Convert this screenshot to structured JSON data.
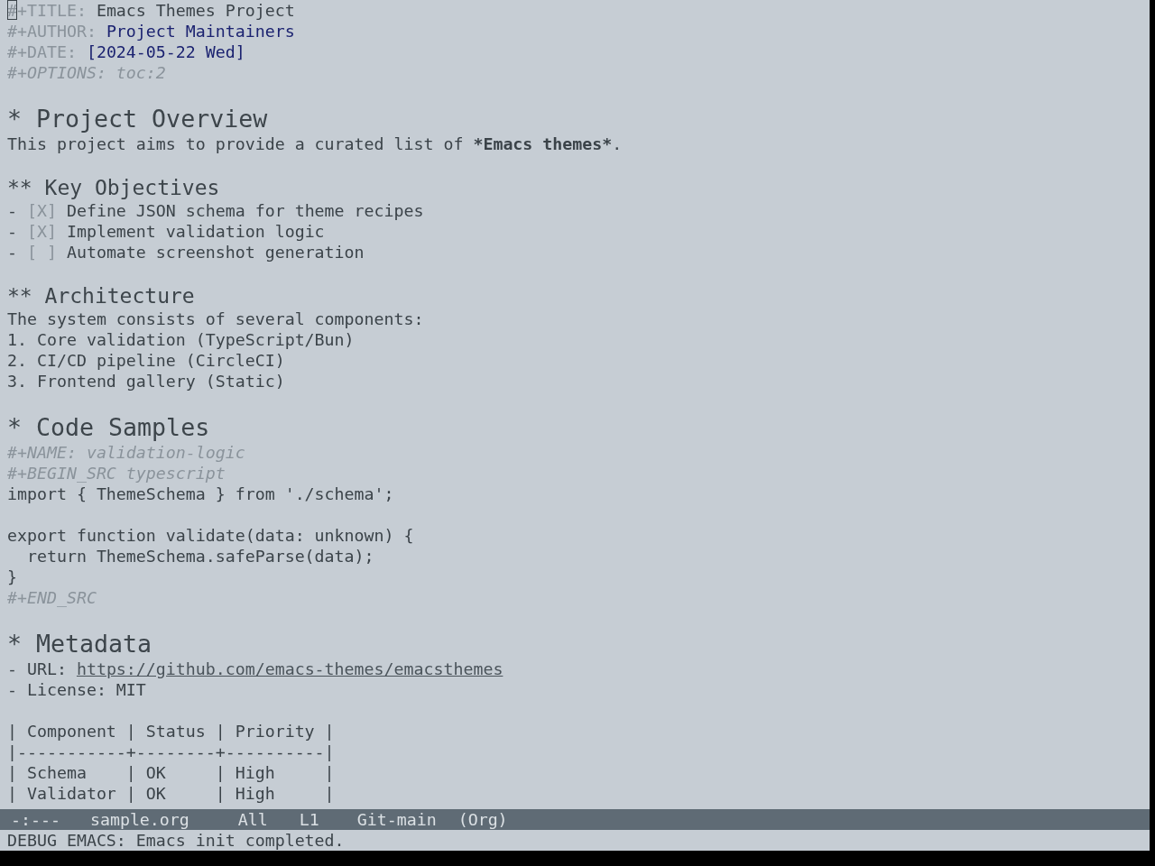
{
  "buffer": {
    "keywords": [
      {
        "kind": "title",
        "key": "#+TITLE:",
        "value": "Emacs Themes Project",
        "cursor": true
      },
      {
        "kind": "author",
        "key": "#+AUTHOR:",
        "value": "Project Maintainers",
        "cursor": false
      },
      {
        "kind": "date",
        "key": "#+DATE:",
        "value": "[2024-05-22 Wed]",
        "cursor": false
      },
      {
        "kind": "option",
        "key": "#+OPTIONS:",
        "value": "toc:2",
        "cursor": false
      }
    ],
    "outline": [
      {
        "heading": "* Project Overview",
        "body": [
          {
            "kind": "paragraph",
            "parts": [
              {
                "text": "This project aims to provide a curated list of ",
                "bold": false
              },
              {
                "text": "*Emacs themes*",
                "bold": true
              },
              {
                "text": ".",
                "bold": false
              }
            ]
          }
        ],
        "children": [
          {
            "heading": "** Key Objectives",
            "body": [
              {
                "kind": "checklist",
                "items": [
                  {
                    "bullet": "-",
                    "box": "[X]",
                    "label": "Define JSON schema for theme recipes"
                  },
                  {
                    "bullet": "-",
                    "box": "[X]",
                    "label": "Implement validation logic"
                  },
                  {
                    "bullet": "-",
                    "box": "[ ]",
                    "label": "Automate screenshot generation"
                  }
                ]
              }
            ]
          },
          {
            "heading": "** Architecture",
            "body": [
              {
                "kind": "paragraph",
                "parts": [
                  {
                    "text": "The system consists of several components:",
                    "bold": false
                  }
                ]
              },
              {
                "kind": "numbered",
                "items": [
                  "1. Core validation (TypeScript/Bun)",
                  "2. CI/CD pipeline (CircleCI)",
                  "3. Frontend gallery (Static)"
                ]
              }
            ]
          }
        ]
      },
      {
        "heading": "* Code Samples",
        "body": [
          {
            "kind": "src_block",
            "name_line": "#+NAME: validation-logic",
            "begin_line": "#+BEGIN_SRC typescript",
            "code": "import { ThemeSchema } from './schema';\n\nexport function validate(data: unknown) {\n  return ThemeSchema.safeParse(data);\n}",
            "end_line": "#+END_SRC"
          }
        ]
      },
      {
        "heading": "* Metadata",
        "body": [
          {
            "kind": "list",
            "items": [
              {
                "text": "- URL:",
                "link": "https://github.com/emacs-themes/emacsthemes"
              },
              {
                "text": "- License: MIT"
              }
            ]
          },
          {
            "kind": "table",
            "header": "| Component | Status | Priority |",
            "rule": "|-----------+--------+----------|",
            "rows": [
              "| Schema    | OK     | High     |",
              "| Validator | OK     | High     |"
            ]
          }
        ]
      }
    ]
  },
  "mode_line": {
    "status": "-:---",
    "buffer_name": "sample.org",
    "position": "All",
    "line": "L1",
    "vc_branch": "Git-main",
    "major_mode": "(Org)"
  },
  "echo_area": {
    "message": "DEBUG EMACS: Emacs init completed."
  }
}
